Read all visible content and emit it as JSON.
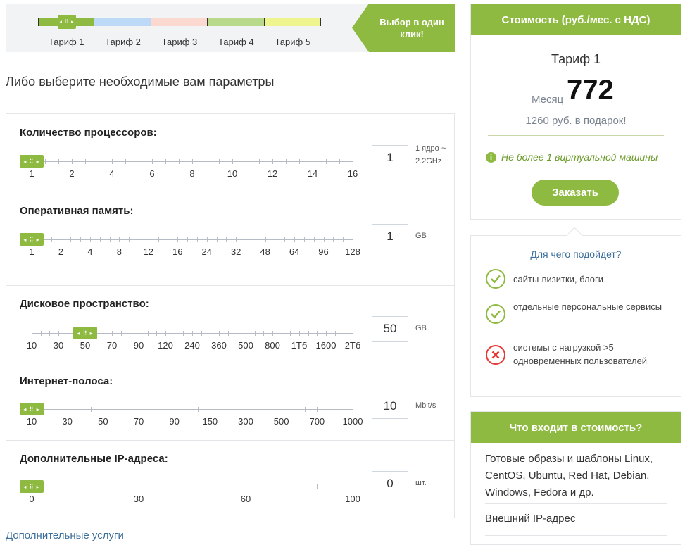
{
  "tariffs": {
    "labels": [
      "Тариф 1",
      "Тариф 2",
      "Тариф 3",
      "Тариф 4",
      "Тариф 5"
    ],
    "colors": [
      "#8fba42",
      "#bcd9f7",
      "#fbd9d0",
      "#b9d98a",
      "#eef58f"
    ],
    "one_click": "Выбор в один клик!"
  },
  "subtitle": "Либо выберите необходимые вам параметры",
  "params": [
    {
      "title": "Количество процессоров:",
      "value": "1",
      "unit": "1 ядро ~ 2.2GHz",
      "ticks": [
        "1",
        "2",
        "4",
        "6",
        "8",
        "10",
        "12",
        "14",
        "16"
      ],
      "selected_index": 0
    },
    {
      "title": "Оперативная память:",
      "value": "1",
      "unit": "GB",
      "ticks": [
        "1",
        "2",
        "4",
        "8",
        "12",
        "16",
        "24",
        "32",
        "48",
        "64",
        "96",
        "128"
      ],
      "selected_index": 0
    },
    {
      "title": "Дисковое пространство:",
      "value": "50",
      "unit": "GB",
      "ticks": [
        "10",
        "30",
        "50",
        "70",
        "90",
        "120",
        "240",
        "360",
        "500",
        "800",
        "1Тб",
        "1600",
        "2Тб"
      ],
      "selected_index": 2
    },
    {
      "title": "Интернет-полоса:",
      "value": "10",
      "unit": "Mbit/s",
      "ticks": [
        "10",
        "30",
        "50",
        "70",
        "90",
        "150",
        "300",
        "500",
        "700",
        "1000"
      ],
      "selected_index": 0
    },
    {
      "title": "Дополнительные IP-адреса:",
      "value": "0",
      "unit": "шт.",
      "ticks": [
        "0",
        "30",
        "60",
        "100"
      ],
      "selected_index": 0
    }
  ],
  "more_services": "Дополнительные услуги",
  "price": {
    "header": "Стоимость (руб./мес. с НДС)",
    "tariff": "Тариф 1",
    "period": "Месяц",
    "amount": "772",
    "gift": "1260 руб. в подарок!",
    "note": "Не более 1 виртуальной машины",
    "order": "Заказать"
  },
  "suitability": {
    "title": "Для чего подойдет?",
    "items": [
      {
        "text": "сайты-визитки, блоги",
        "icon": "check-icon"
      },
      {
        "text": "отдельные персональные сервисы",
        "icon": "check-icon"
      },
      {
        "text": "системы с нагрузкой >5 одновременных пользователей",
        "icon": "cross-icon"
      }
    ]
  },
  "included": {
    "header": "Что входит в стоимость?",
    "items": [
      "Готовые образы и шаблоны Linux, CentOS, Ubuntu, Red Hat, Debian, Windows, Fedora и др.",
      "Внешний IP-адрес"
    ]
  },
  "colors": {
    "accent": "#8fba42",
    "link": "#3b6e9a",
    "cross": "#e53935"
  }
}
